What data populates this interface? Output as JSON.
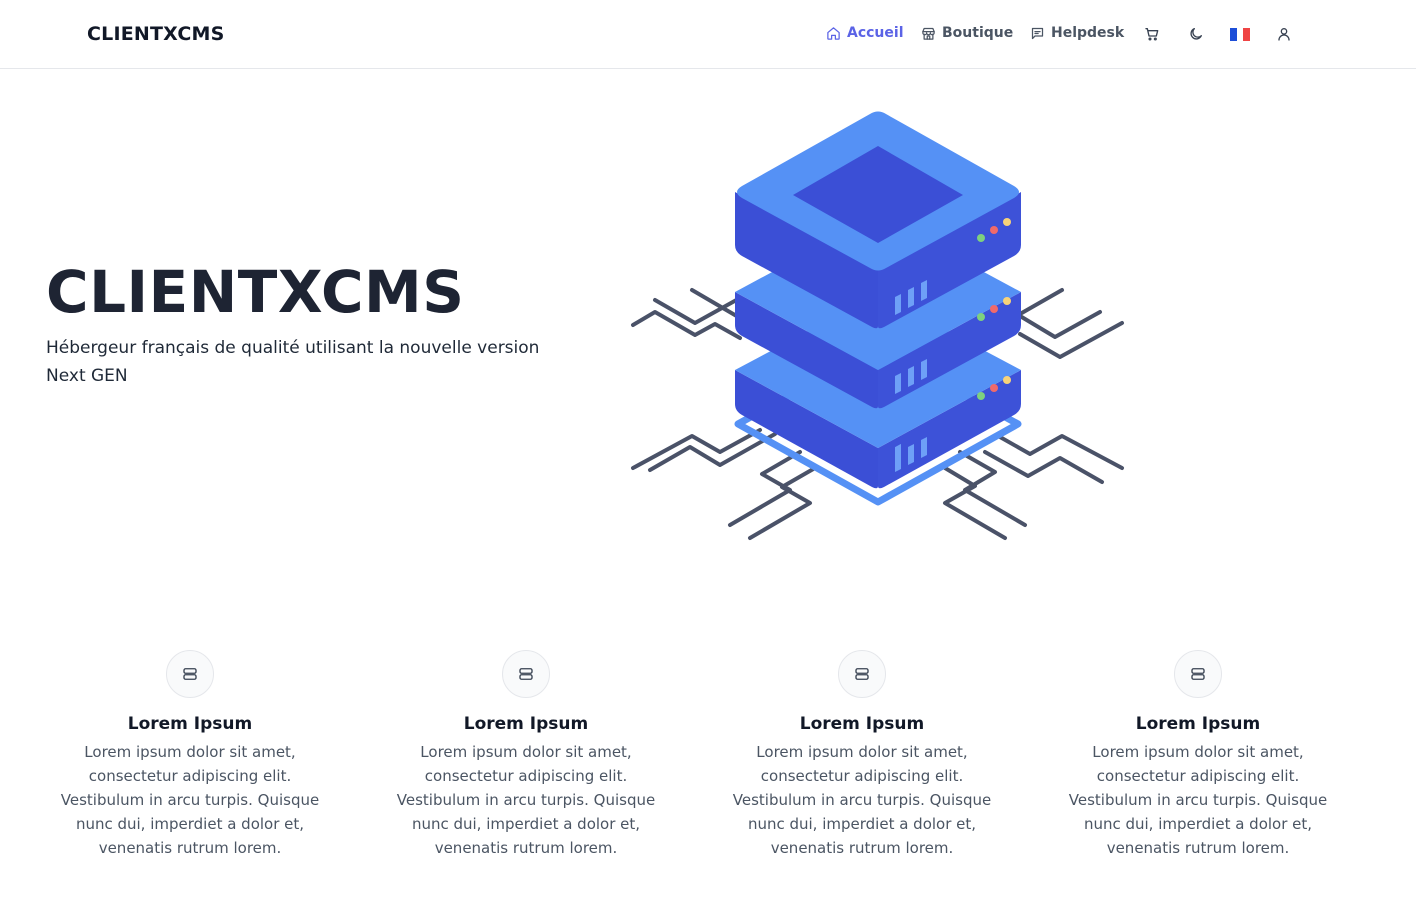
{
  "brand": "CLIENTXCMS",
  "nav": {
    "links": [
      {
        "label": "Accueil",
        "icon": "home-icon",
        "active": true
      },
      {
        "label": "Boutique",
        "icon": "store-icon",
        "active": false
      },
      {
        "label": "Helpdesk",
        "icon": "message-icon",
        "active": false
      }
    ],
    "icons": [
      "cart-icon",
      "moon-icon",
      "flag-fr-icon",
      "user-icon"
    ]
  },
  "hero": {
    "title": "CLIENTXCMS",
    "subtitle": "Hébergeur français de qualité utilisant la nouvelle version Next GEN"
  },
  "features": [
    {
      "title": "Lorem Ipsum",
      "text": "Lorem ipsum dolor sit amet, consectetur adipiscing elit. Vestibulum in arcu turpis. Quisque nunc dui, imperdiet a dolor et, venenatis rutrum lorem.",
      "icon": "server-icon"
    },
    {
      "title": "Lorem Ipsum",
      "text": "Lorem ipsum dolor sit amet, consectetur adipiscing elit. Vestibulum in arcu turpis. Quisque nunc dui, imperdiet a dolor et, venenatis rutrum lorem.",
      "icon": "server-icon"
    },
    {
      "title": "Lorem Ipsum",
      "text": "Lorem ipsum dolor sit amet, consectetur adipiscing elit. Vestibulum in arcu turpis. Quisque nunc dui, imperdiet a dolor et, venenatis rutrum lorem.",
      "icon": "server-icon"
    },
    {
      "title": "Lorem Ipsum",
      "text": "Lorem ipsum dolor sit amet, consectetur adipiscing elit. Vestibulum in arcu turpis. Quisque nunc dui, imperdiet a dolor et, venenatis rutrum lorem.",
      "icon": "server-icon"
    }
  ],
  "colors": {
    "accent": "#5b63e6",
    "server_light": "#5591f5",
    "server_dark": "#3b4fd6",
    "circuit": "#4a5268"
  }
}
